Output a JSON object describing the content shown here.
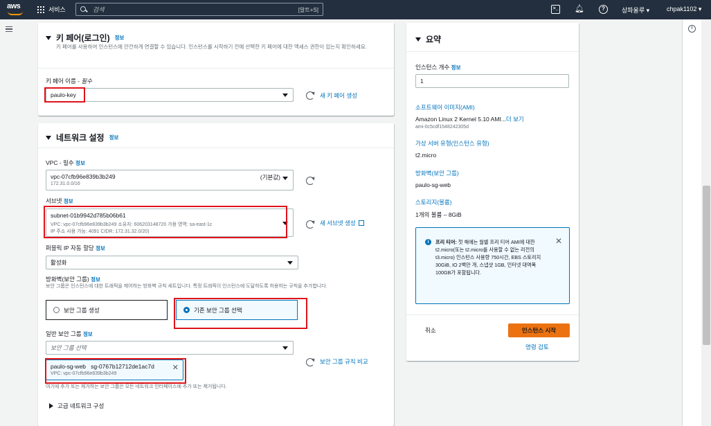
{
  "topnav": {
    "logo_text": "aws",
    "services_label": "서비스",
    "search_placeholder": "검색",
    "search_shortcut": "[알트+S]",
    "region": "상파울루 ▾",
    "account": "chpak1102 ▾"
  },
  "keypair": {
    "title": "키 페어(로그인)",
    "info": "정보",
    "description": "키 페어를 사용하여 인스턴스에 안전하게 연결할 수 있습니다. 인스턴스를 시작하기 전에 선택한 키 페어에 대한 액세스 권한이 있는지 확인하세요.",
    "name_label": "키 페어 이름 - ",
    "name_required": "필수",
    "selected": "paulo-key",
    "create_link": "새 키 페어 생성"
  },
  "network": {
    "title": "네트워크 설정",
    "info": "정보",
    "vpc_label": "VPC - 필수",
    "vpc_info": "정보",
    "vpc_id": "vpc-07cfb96e839b3b249",
    "vpc_default": "(기본값)",
    "vpc_cidr": "172.31.0.0/16",
    "subnet_label": "서브넷",
    "subnet_info": "정보",
    "subnet_id": "subnet-01b9942d785b06b61",
    "subnet_line2": "VPC: vpc-07cfb96e839b3b249     소유자: 606203148720     가용 영역: sa-east-1c",
    "subnet_line3": "IP 주소 사용 가능: 4091     CIDR: 172.31.32.0/20)",
    "subnet_create_link": "새 서브넷 생성",
    "public_ip_label": "퍼블릭 IP 자동 할당",
    "public_ip_info": "정보",
    "public_ip_value": "활성화",
    "firewall_label": "방화벽(보안 그룹)",
    "firewall_info": "정보",
    "firewall_desc": "보안 그룹은 인스턴스에 대한 트래픽을 제어하는 방화벽 규칙 세트입니다. 특정 트래픽이 인스턴스에 도달하도록 허용하는 규칙을 추가합니다.",
    "sg_create_option": "보안 그룹 생성",
    "sg_existing_option": "기존 보안 그룹 선택",
    "common_sg_label": "일반 보안 그룹",
    "common_sg_info": "정보",
    "sg_select_placeholder": "보안 그룹 선택",
    "sg_compare_link": "보안 그룹 규칙 비교",
    "token_name": "paulo-sg-web",
    "token_id": "sg-0767b12712de1ac7d",
    "token_vpc": "VPC: vpc-07cfb96e839b3b249",
    "sg_note": "여기에 추가 또는 제거하는 보안 그룹은 모든 네트워크 인터페이스에 추가 또는 제거됩니다.",
    "advanced": "고급 네트워크 구성"
  },
  "summary": {
    "title": "요약",
    "instances_label": "인스턴스 개수",
    "instances_info": "정보",
    "instances_value": "1",
    "ami_label": "소프트웨어 이미지(AMI)",
    "ami_value": "Amazon Linux 2 Kernel 5.10 AMI...",
    "ami_more": "더 보기",
    "ami_id": "ami-0c5cdf1548242305d",
    "type_label": "가상 서버 유형(인스턴스 유형)",
    "type_value": "t2.micro",
    "firewall_label": "방화벽(보안 그룹)",
    "firewall_value": "paulo-sg-web",
    "storage_label": "스토리지(볼륨)",
    "storage_value": "1개의 볼륨 – 8GiB",
    "freetier_title": "프리 티어:",
    "freetier_text": " 첫 해에는 월별 프리 티어 AMI에 대한 t2.micro(또는 t2.micro를 사용할 수 없는 리전의 t3.micro) 인스턴스 사용량 750시간, EBS 스토리지 30GiB, IO 2백만 개, 스냅샷 1GB, 인터넷 대역폭 100GB가 포함됩니다.",
    "cancel": "취소",
    "launch": "인스턴스 시작",
    "review": "명령 검토"
  },
  "colors": {
    "nav_bg": "#232f3e",
    "link": "#0073bb",
    "primary_button": "#ec7211",
    "highlight_box": "#e0121a"
  }
}
